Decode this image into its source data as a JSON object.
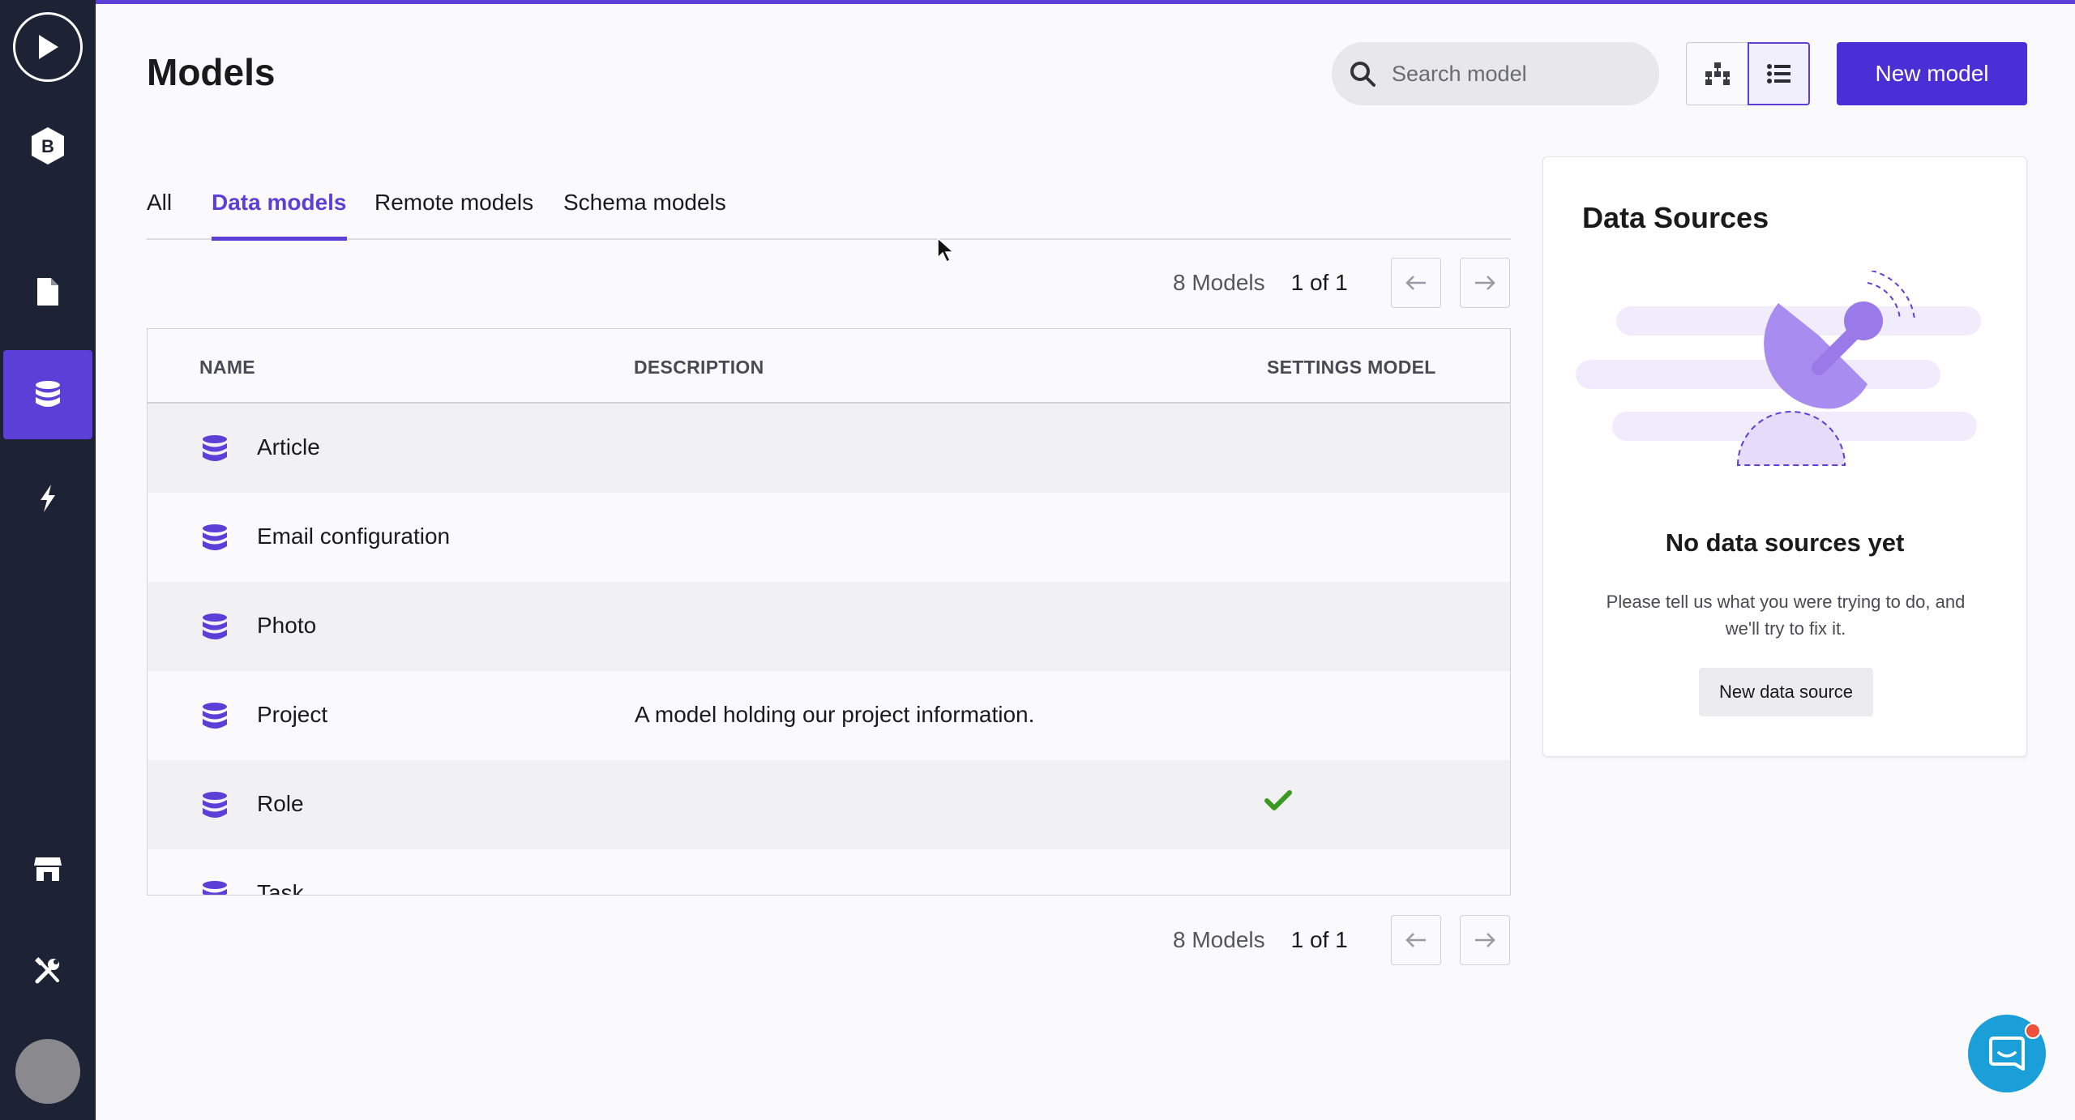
{
  "header": {
    "title": "Models",
    "search_placeholder": "Search model",
    "new_model_label": "New model"
  },
  "tabs": [
    {
      "label": "All",
      "active": false
    },
    {
      "label": "Data models",
      "active": true
    },
    {
      "label": "Remote models",
      "active": false
    },
    {
      "label": "Schema models",
      "active": false
    }
  ],
  "pagination": {
    "count": "8 Models",
    "pages": "1 of 1"
  },
  "table": {
    "columns": [
      "NAME",
      "DESCRIPTION",
      "SETTINGS MODEL"
    ],
    "rows": [
      {
        "name": "Article",
        "description": "",
        "settings_model": false
      },
      {
        "name": "Email configuration",
        "description": "",
        "settings_model": false
      },
      {
        "name": "Photo",
        "description": "",
        "settings_model": false
      },
      {
        "name": "Project",
        "description": "A model holding our project information.",
        "settings_model": true
      },
      {
        "name": "Role",
        "description": "",
        "settings_model": true
      },
      {
        "name": "Task",
        "description": "",
        "settings_model": false
      }
    ]
  },
  "data_sources": {
    "title": "Data Sources",
    "empty_title": "No data sources yet",
    "empty_text": "Please tell us what you were trying to do, and we'll try to fix it.",
    "button_label": "New data source"
  },
  "sidebar": {
    "logo_letter": "B",
    "items": [
      {
        "icon": "play-icon"
      },
      {
        "icon": "b-logo-icon"
      },
      {
        "icon": "document-icon"
      },
      {
        "icon": "database-icon",
        "active": true
      },
      {
        "icon": "bolt-icon"
      },
      {
        "icon": "store-icon"
      },
      {
        "icon": "tools-icon"
      },
      {
        "icon": "avatar"
      }
    ]
  },
  "colors": {
    "accent": "#5b3fd6",
    "sidebar": "#1e2235",
    "check": "#3a9a1f",
    "chat": "#1b9fd8"
  }
}
